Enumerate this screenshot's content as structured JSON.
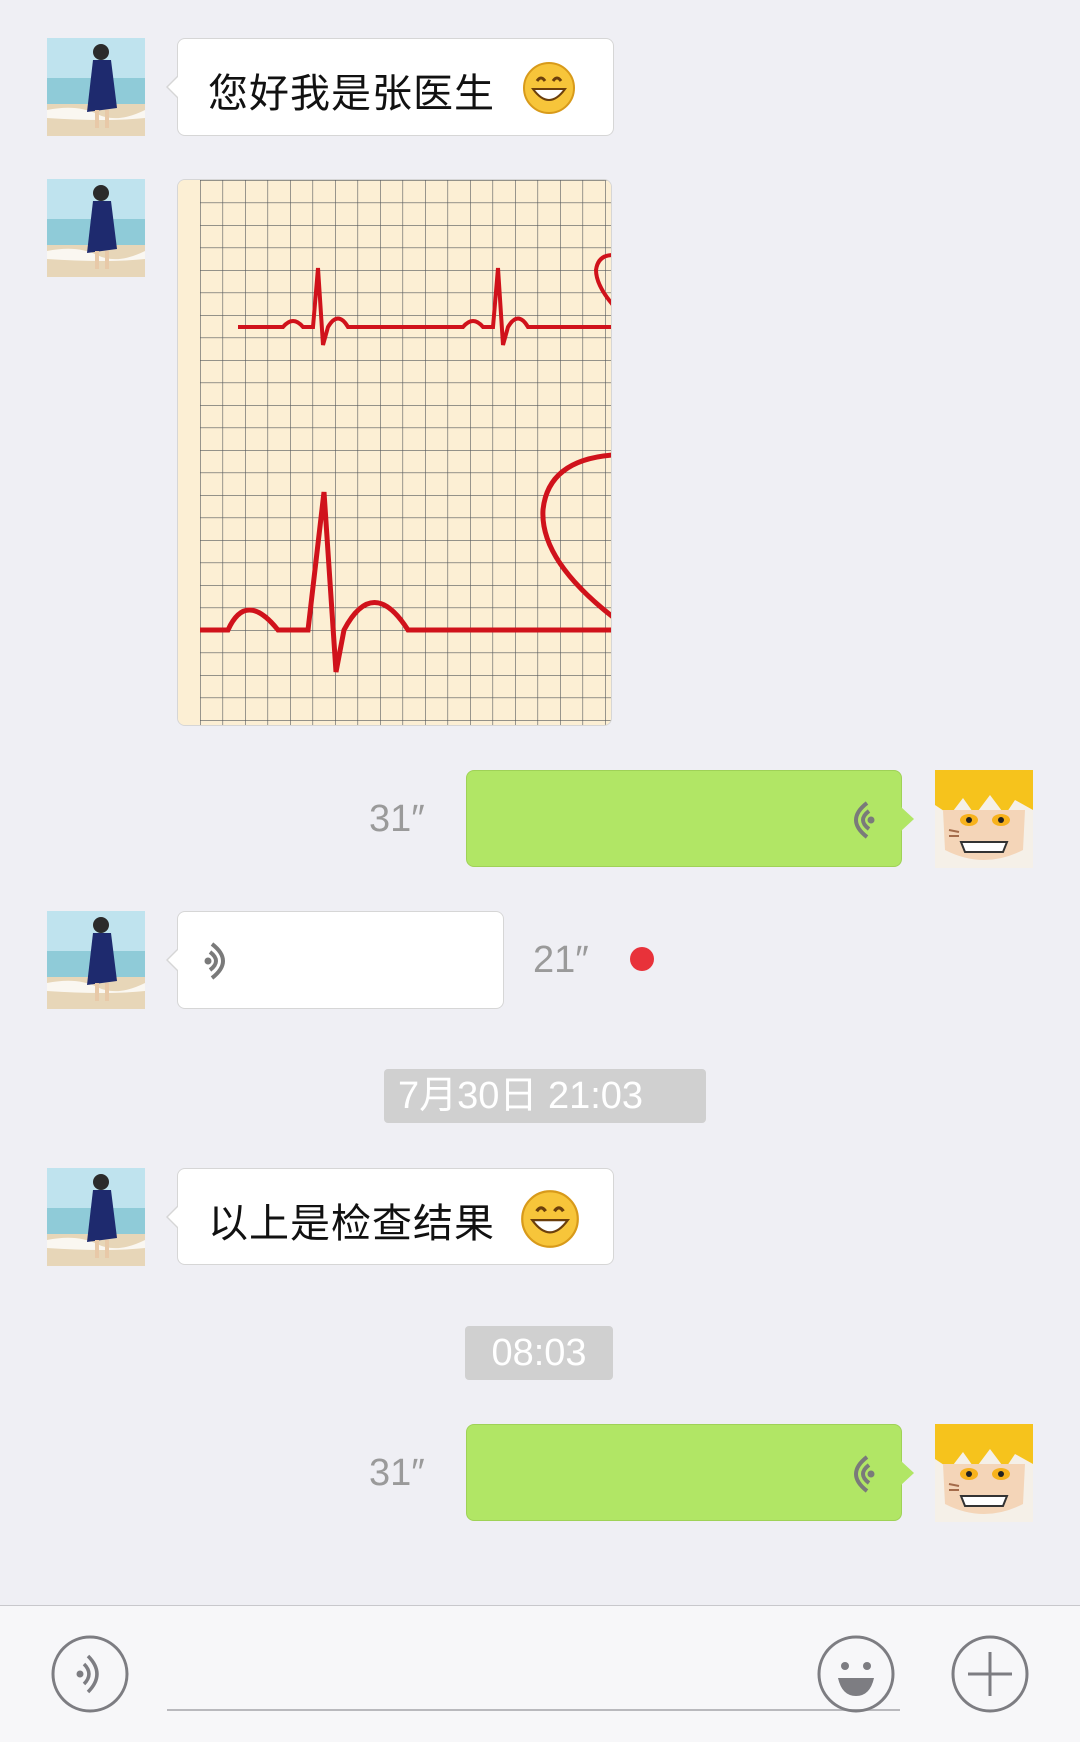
{
  "messages": {
    "m1_text": "您好我是张医生",
    "m3_duration": "31″",
    "m4_duration": "21″",
    "timestamp1": "7月30日 21:03",
    "m5_text": "以上是检查结果",
    "timestamp2": "08:03",
    "m6_duration": "31″"
  },
  "colors": {
    "chat_background": "#efeff4",
    "sent_bubble": "#b1e665",
    "received_bubble": "#ffffff",
    "unread_dot": "#e8323a",
    "ecg_line": "#d0121b"
  },
  "icons": {
    "voice_toggle": "voice-icon",
    "emoji": "smiley-icon",
    "more": "plus-icon"
  }
}
